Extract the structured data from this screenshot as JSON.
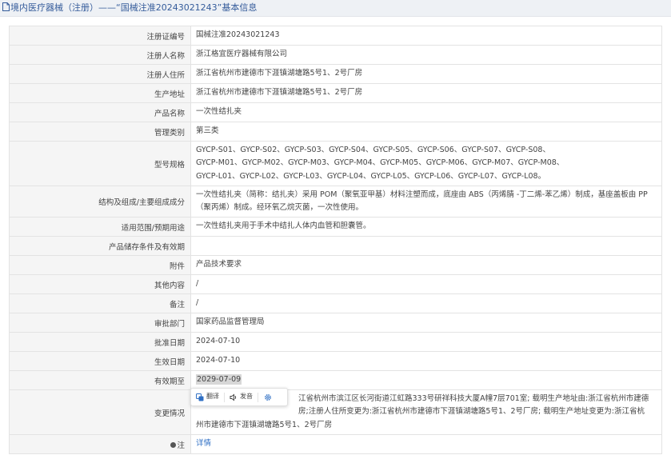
{
  "header": {
    "title": "境内医疗器械（注册）——“国械注准20243021243”基本信息"
  },
  "rows": {
    "reg_no": {
      "label": "注册证编号",
      "value": "国械注准20243021243"
    },
    "registrant": {
      "label": "注册人名称",
      "value": "浙江格宜医疗器械有限公司"
    },
    "residence": {
      "label": "注册人住所",
      "value": "浙江省杭州市建德市下涯镇湖塘路5号1、2号厂房"
    },
    "address": {
      "label": "生产地址",
      "value": "浙江省杭州市建德市下涯镇湖塘路5号1、2号厂房"
    },
    "product": {
      "label": "产品名称",
      "value": "一次性结扎夹"
    },
    "category": {
      "label": "管理类别",
      "value": "第三类"
    },
    "model": {
      "label": "型号规格",
      "lines": [
        "GYCP-S01、GYCP-S02、GYCP-S03、GYCP-S04、GYCP-S05、GYCP-S06、GYCP-S07、GYCP-S08、",
        "GYCP-M01、GYCP-M02、GYCP-M03、GYCP-M04、GYCP-M05、GYCP-M06、GYCP-M07、GYCP-M08、",
        "GYCP-L01、GYCP-L02、GYCP-L03、GYCP-L04、GYCP-L05、GYCP-L06、GYCP-L07、GYCP-L08。"
      ]
    },
    "structure": {
      "label": "结构及组成/主要组成成分",
      "lines": [
        "一次性结扎夹（简称：结扎夹）采用 POM（聚氧亚甲基）材料注塑而成，底座由 ABS（丙烯腈 -丁二烯-苯乙烯）制成，基座盖板由 PP",
        "（聚丙烯）制成。经环氧乙烷灭菌，一次性使用。"
      ]
    },
    "scope": {
      "label": "适用范围/预期用途",
      "value": "一次性结扎夹用于手术中结扎人体内血管和胆囊管。"
    },
    "storage": {
      "label": "产品储存条件及有效期",
      "value": ""
    },
    "attachment": {
      "label": "附件",
      "value": "产品技术要求"
    },
    "other": {
      "label": "其他内容",
      "value": "/"
    },
    "remark": {
      "label": "备注",
      "value": "/"
    },
    "dept": {
      "label": "审批部门",
      "value": "国家药品监督管理局"
    },
    "approve": {
      "label": "批准日期",
      "value": "2024-07-10"
    },
    "effective": {
      "label": "生效日期",
      "value": "2024-07-10"
    },
    "expiry": {
      "label": "有效期至",
      "value": "2029-07-09"
    },
    "changes": {
      "label": "变更情况",
      "lines": [
        "江省杭州市滨江区长河街道江虹路333号研祥科技大厦A幢7层701室; 载明生产地址由:浙江省杭州市建德",
        "房;注册人住所变更为:浙江省杭州市建德市下涯镇湖塘路5号1、2号厂房; 载明生产地址变更为:浙江省杭",
        "州市建德市下涯镇湖塘路5号1、2号厂房"
      ]
    },
    "note": {
      "label": "注",
      "value": "详情"
    }
  },
  "translate_popup": {
    "translate_label": "翻译",
    "read_label": "发音"
  },
  "colors": {
    "header_bg": "#eef1f5",
    "header_text": "#355c9b",
    "label_bg": "#f5f5f5",
    "border": "#e3e3e3",
    "link": "#2f6fc4",
    "highlight": "#d7d7d7"
  }
}
